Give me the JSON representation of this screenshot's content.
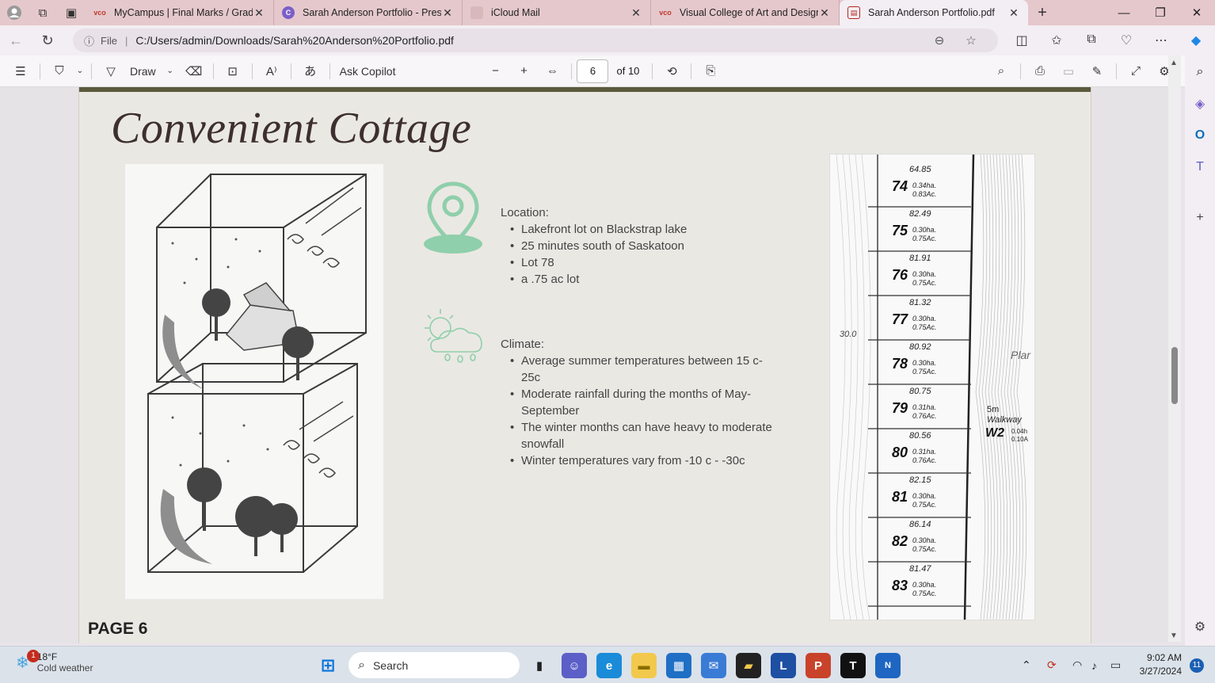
{
  "browser": {
    "tabs": [
      {
        "title": "MyCampus | Final Marks / Grade",
        "favicon": "vco-icon",
        "active": false
      },
      {
        "title": "Sarah Anderson Portfolio - Prese",
        "favicon": "canva-icon",
        "active": false
      },
      {
        "title": "iCloud Mail",
        "favicon": "icloud-icon",
        "active": false
      },
      {
        "title": "Visual College of Art and Design",
        "favicon": "vco-icon",
        "active": false
      },
      {
        "title": "Sarah Anderson Portfolio.pdf",
        "favicon": "pdf-icon",
        "active": true
      }
    ],
    "address": {
      "scheme_label": "File",
      "path": "C:/Users/admin/Downloads/Sarah%20Anderson%20Portfolio.pdf"
    }
  },
  "pdf_toolbar": {
    "draw_label": "Draw",
    "copilot_label": "Ask Copilot",
    "page_current": "6",
    "page_total_label": "of 10"
  },
  "document": {
    "title": "Convenient Cottage",
    "location": {
      "heading": "Location:",
      "items": [
        "Lakefront lot on Blackstrap lake",
        "25 minutes south of Saskatoon",
        "Lot 78",
        "a .75 ac lot"
      ]
    },
    "climate": {
      "heading": "Climate:",
      "items": [
        "Average summer temperatures between 15 c- 25c",
        "Moderate rainfall during the months of May- September",
        "The winter months can have heavy to moderate snowfall",
        "Winter temperatures vary from -10 c - -30c"
      ]
    },
    "map_lots": [
      {
        "lot": "74",
        "area": "0.34ha.",
        "acres": "0.83Ac.",
        "frontage": "64.85"
      },
      {
        "lot": "75",
        "area": "0.30ha.",
        "acres": "0.75Ac.",
        "frontage": "82.49"
      },
      {
        "lot": "76",
        "area": "0.30ha.",
        "acres": "0.75Ac.",
        "frontage": "81.91"
      },
      {
        "lot": "77",
        "area": "0.30ha.",
        "acres": "0.75Ac.",
        "frontage": "81.32"
      },
      {
        "lot": "78",
        "area": "0.30ha.",
        "acres": "0.75Ac.",
        "frontage": "80.92"
      },
      {
        "lot": "79",
        "area": "0.31ha.",
        "acres": "0.76Ac.",
        "frontage": "80.75"
      },
      {
        "lot": "80",
        "area": "0.31ha.",
        "acres": "0.76Ac.",
        "frontage": "80.56"
      },
      {
        "lot": "81",
        "area": "0.30ha.",
        "acres": "0.75Ac.",
        "frontage": "82.15"
      },
      {
        "lot": "82",
        "area": "0.30ha.",
        "acres": "0.75Ac.",
        "frontage": "86.14"
      },
      {
        "lot": "83",
        "area": "0.30ha.",
        "acres": "0.75Ac.",
        "frontage": "81.47"
      }
    ],
    "map_walkway": {
      "label_line1": "5m",
      "label_line2": "Walkway",
      "code": "W2",
      "area": "0.04h",
      "acres": "0.10A"
    },
    "map_side_label": "Plar",
    "map_contour_label": "30.0",
    "page_label": "PAGE 6"
  },
  "taskbar": {
    "weather_temp": "18°F",
    "weather_desc": "Cold weather",
    "weather_badge": "1",
    "search_placeholder": "Search",
    "time": "9:02 AM",
    "date": "3/27/2024",
    "notification_count": "11"
  }
}
